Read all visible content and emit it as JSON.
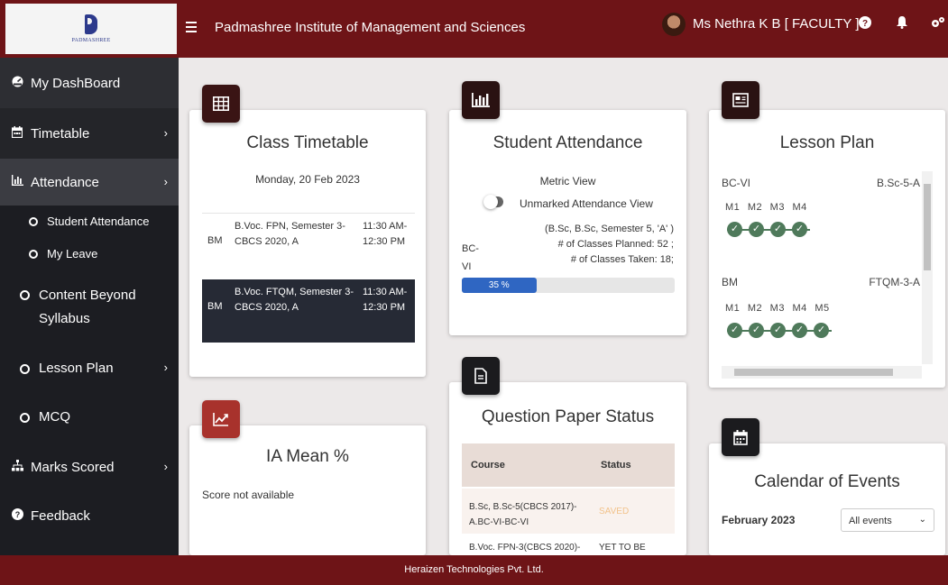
{
  "header": {
    "logo_text": "PADMASHREE",
    "institute": "Padmashree Institute of Management and Sciences",
    "user": "Ms Nethra K B [ FACULTY ]"
  },
  "sidebar": {
    "items": [
      {
        "label": "My DashBoard",
        "icon": "dashboard-icon"
      },
      {
        "label": "Timetable",
        "icon": "calendar-icon"
      },
      {
        "label": "Attendance",
        "icon": "bar-chart-icon"
      },
      {
        "label": "Student Attendance"
      },
      {
        "label": "My Leave"
      },
      {
        "label": "Content Beyond Syllabus"
      },
      {
        "label": "Lesson Plan"
      },
      {
        "label": "MCQ"
      },
      {
        "label": "Marks Scored",
        "icon": "sitemap-icon"
      },
      {
        "label": "Feedback",
        "icon": "question-icon"
      }
    ]
  },
  "timetable": {
    "title": "Class Timetable",
    "date": "Monday, 20 Feb 2023",
    "rows": [
      {
        "code": "BM",
        "course": "B.Voc. FPN, Semester 3- CBCS 2020, A",
        "time": "11:30 AM-12:30 PM"
      },
      {
        "code": "BM",
        "course": "B.Voc. FTQM, Semester 3- CBCS 2020, A",
        "time": "11:30 AM-12:30 PM"
      }
    ]
  },
  "attendance": {
    "title": "Student Attendance",
    "metric_view": "Metric View",
    "unmarked_view": "Unmarked Attendance View",
    "class_label": "BC-VI",
    "detail": "(B.Sc, B.Sc, Semester 5, 'A' )",
    "planned": "# of Classes Planned: 52 ;",
    "taken": "# of Classes Taken: 18;",
    "progress_label": "35 %",
    "progress": 35
  },
  "lesson_plan": {
    "title": "Lesson Plan",
    "groups": [
      {
        "subject": "BC-VI",
        "class": "B.Sc-5-A",
        "modules": "M1 M2 M3 M4",
        "count": 4
      },
      {
        "subject": "BM",
        "class": "FTQM-3-A",
        "modules": "M1 M2 M3 M4 M5",
        "count": 5
      }
    ]
  },
  "ia_mean": {
    "title": "IA Mean %",
    "text": "Score not available"
  },
  "question_paper": {
    "title": "Question Paper Status",
    "col_course": "Course",
    "col_status": "Status",
    "rows": [
      {
        "course": "B.Sc, B.Sc-5(CBCS 2017)-A.BC-VI-BC-VI",
        "status": "SAVED"
      },
      {
        "course": "B.Voc. FPN-3(CBCS 2020)-",
        "status": "YET TO BE"
      }
    ]
  },
  "calendar": {
    "title": "Calendar of Events",
    "month": "February 2023",
    "filter": "All events"
  },
  "footer": {
    "text": "Heraizen Technologies Pvt. Ltd."
  },
  "colors": {
    "header": "#6e1417",
    "sidebar": "#1c1d22",
    "progress": "#2f66c2",
    "lesson_dot": "#4f7a5b",
    "ia_icon": "#a8322c"
  }
}
